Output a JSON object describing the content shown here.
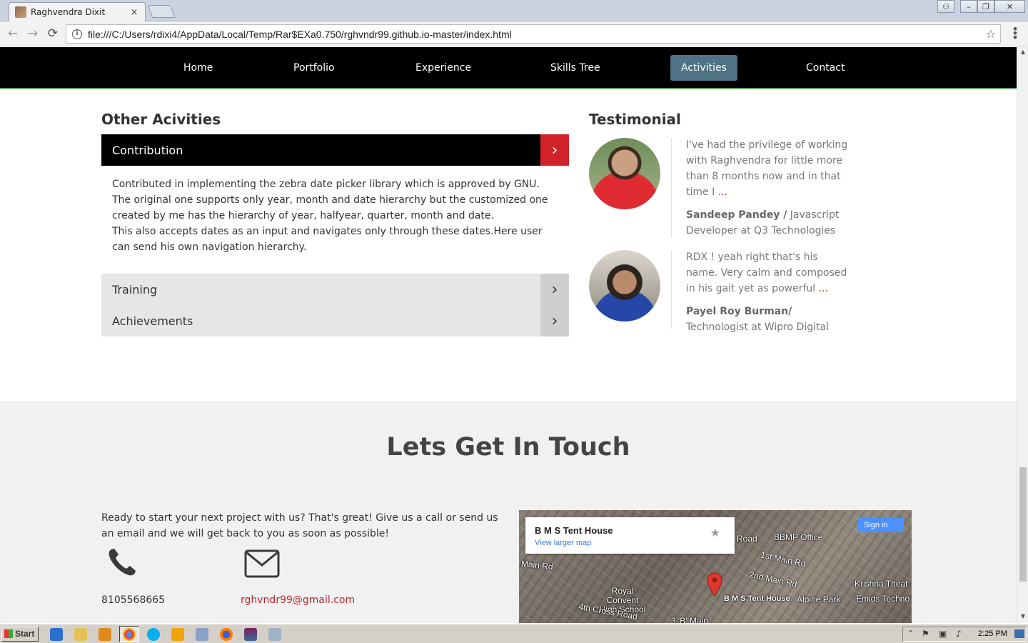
{
  "browser": {
    "tab_title": "Raghvendra Dixit",
    "tab_close": "×",
    "url": "file:///C:/Users/rdixi4/AppData/Local/Temp/Rar$EXa0.750/rghvndr99.github.io-master/index.html",
    "back_icon": "←",
    "forward_icon": "→",
    "reload_icon": "⟳",
    "star_icon": "☆",
    "menu_icon": "⋮"
  },
  "nav": {
    "items": [
      {
        "label": "Home"
      },
      {
        "label": "Portfolio"
      },
      {
        "label": "Experience"
      },
      {
        "label": "Skills Tree"
      },
      {
        "label": "Activities",
        "active": true
      },
      {
        "label": "Contact"
      }
    ],
    "active_color": "#4f7384"
  },
  "activities": {
    "title": "Other Acivities",
    "accordion": [
      {
        "label": "Contribution",
        "expanded": true,
        "body": [
          "Contributed in implementing the zebra date picker library which is approved by GNU. The original one supports only year, month and date hierarchy but the customized one created by me has the hierarchy of year, halfyear, quarter, month and date.",
          "This also accepts dates as an input and navigates only through these dates.Here user can send his own navigation hierarchy."
        ]
      },
      {
        "label": "Training",
        "expanded": false
      },
      {
        "label": "Achievements",
        "expanded": false
      }
    ],
    "arrow_icon": "›",
    "accent": "#d2232a"
  },
  "testimonial": {
    "title": "Testimonial",
    "items": [
      {
        "quote": "I've had the privilege of working with Raghvendra for little more than 8 months now and in that time I",
        "more": "...",
        "author": "Sandeep Pandey /",
        "role": " Javascript Developer at Q3 Technologies"
      },
      {
        "quote": "RDX ! yeah right that's his name. Very calm and composed in his gait yet as powerful",
        "more": "...",
        "author": "Payel Roy Burman/",
        "role": " Technologist at Wipro Digital"
      }
    ]
  },
  "contact": {
    "title": "Lets Get In Touch",
    "text": "Ready to start your next project with us? That's great! Give us a call or send us an email and we will get back to you as soon as possible!",
    "phone": "8105568665",
    "email": "rghvndr99@gmail.com",
    "map": {
      "place": "B M S Tent House",
      "larger_map": "View larger map",
      "sign_in": "Sign in",
      "labels": {
        "road": "Road",
        "bbmp": "BBMP Office",
        "main1": "1st Main Rd",
        "main2": "2nd Main Rd",
        "main": "Main Rd",
        "school": "Royal Convent High School",
        "pin_label": "B M S Tent House",
        "alpine": "Alpine Park",
        "krishna": "Krishna Theat",
        "emids": "Emids Techno",
        "cross": "4th Cross Road",
        "bmain": "3 'B' Main"
      }
    }
  },
  "taskbar": {
    "start": "Start",
    "clock": "2:25 PM"
  }
}
